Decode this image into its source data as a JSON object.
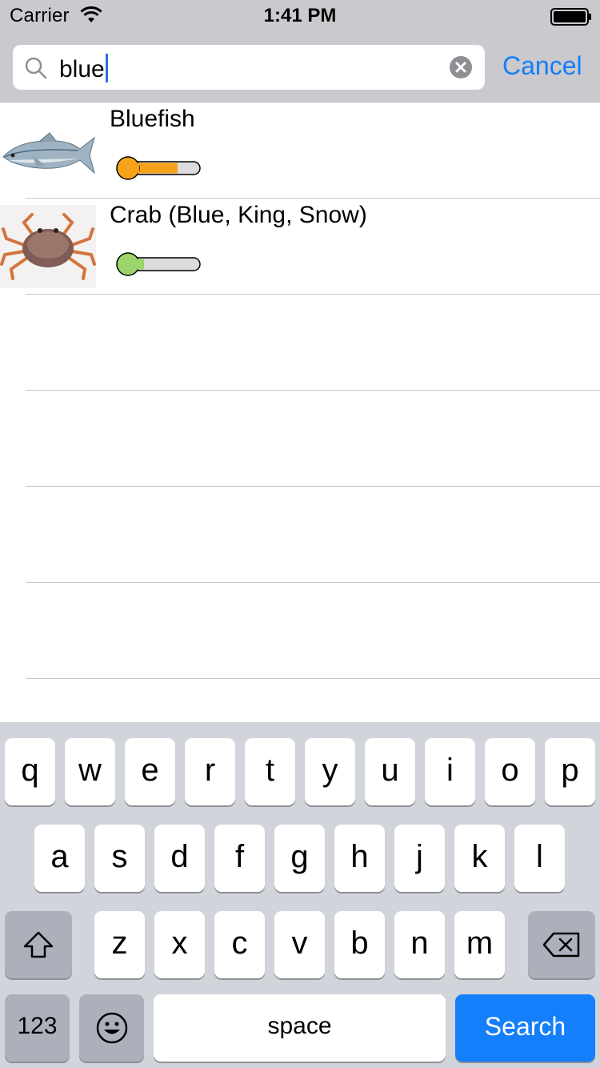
{
  "status_bar": {
    "carrier": "Carrier",
    "time": "1:41 PM"
  },
  "search": {
    "query": "blue",
    "cancel_label": "Cancel"
  },
  "results": [
    {
      "title": "Bluefish",
      "thumbnail_icon": "bluefish-icon",
      "gauge_color": "#f7a21b",
      "gauge_level": 0.72
    },
    {
      "title": "Crab (Blue, King, Snow)",
      "thumbnail_icon": "crab-icon",
      "gauge_color": "#9bd46a",
      "gauge_level": 0.28
    }
  ],
  "keyboard": {
    "row1": [
      "q",
      "w",
      "e",
      "r",
      "t",
      "y",
      "u",
      "i",
      "o",
      "p"
    ],
    "row2": [
      "a",
      "s",
      "d",
      "f",
      "g",
      "h",
      "j",
      "k",
      "l"
    ],
    "row3": [
      "z",
      "x",
      "c",
      "v",
      "b",
      "n",
      "m"
    ],
    "numbers_label": "123",
    "space_label": "space",
    "search_label": "Search"
  },
  "colors": {
    "accent": "#147efb",
    "search_key": "#147efb"
  }
}
